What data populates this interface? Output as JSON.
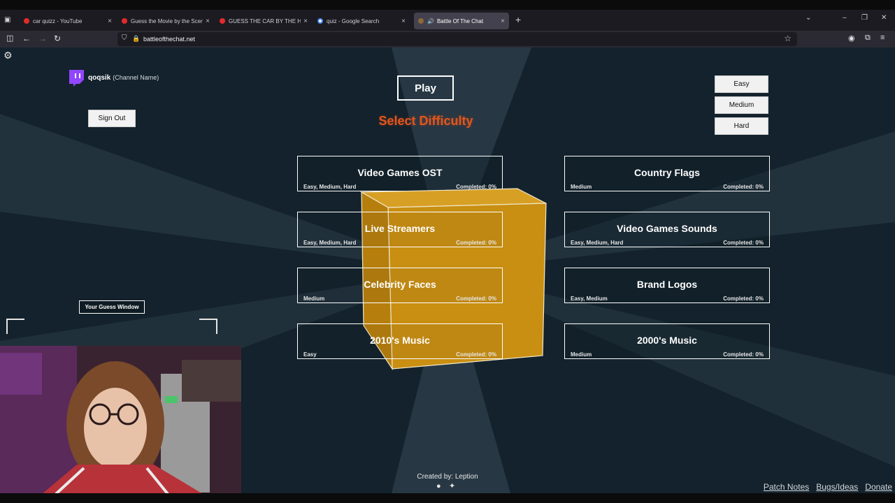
{
  "browser": {
    "tabs": [
      {
        "title": "car quizz - YouTube",
        "favicon": "youtube-icon",
        "active": false
      },
      {
        "title": "Guess the Movie by the Scene |",
        "favicon": "youtube-icon",
        "active": false
      },
      {
        "title": "GUESS THE CAR BY THE HEADL",
        "favicon": "youtube-icon",
        "active": false
      },
      {
        "title": "quiz - Google Search",
        "favicon": "google-icon",
        "active": false
      },
      {
        "title": "Battle Of The Chat",
        "favicon": "speaker-icon",
        "active": true
      }
    ],
    "url": "battleofthechat.net",
    "colors": {
      "tabbar": "#1c1b22",
      "active_tab": "#42414d",
      "navbar": "#2b2a33"
    }
  },
  "page": {
    "channel": {
      "name": "qoqsik",
      "tag": "(Channel Name)"
    },
    "sign_out_label": "Sign Out",
    "play_label": "Play",
    "select_difficulty": "Select Difficulty",
    "difficulty_buttons": [
      "Easy",
      "Medium",
      "Hard"
    ],
    "categories": [
      {
        "name": "Video Games OST",
        "difficulties": "Easy, Medium, Hard",
        "completed": "Completed: 0%"
      },
      {
        "name": "Country Flags",
        "difficulties": "Medium",
        "completed": "Completed: 0%"
      },
      {
        "name": "Live Streamers",
        "difficulties": "Easy, Medium, Hard",
        "completed": "Completed: 0%"
      },
      {
        "name": "Video Games Sounds",
        "difficulties": "Easy, Medium, Hard",
        "completed": "Completed: 0%"
      },
      {
        "name": "Celebrity Faces",
        "difficulties": "Medium",
        "completed": "Completed: 0%"
      },
      {
        "name": "Brand Logos",
        "difficulties": "Easy, Medium",
        "completed": "Completed: 0%"
      },
      {
        "name": "2010's Music",
        "difficulties": "Easy",
        "completed": "Completed: 0%"
      },
      {
        "name": "2000's Music",
        "difficulties": "Medium",
        "completed": "Completed: 0%"
      }
    ],
    "guess_window_label": "Your Guess Window",
    "credit": "Created by: Leption",
    "footer_links": [
      "Patch Notes",
      "Bugs/Ideas",
      "Donate"
    ],
    "colors": {
      "background": "#13222c",
      "accent": "#e2561d",
      "cube": "#c88f12",
      "twitch": "#9146ff"
    }
  }
}
